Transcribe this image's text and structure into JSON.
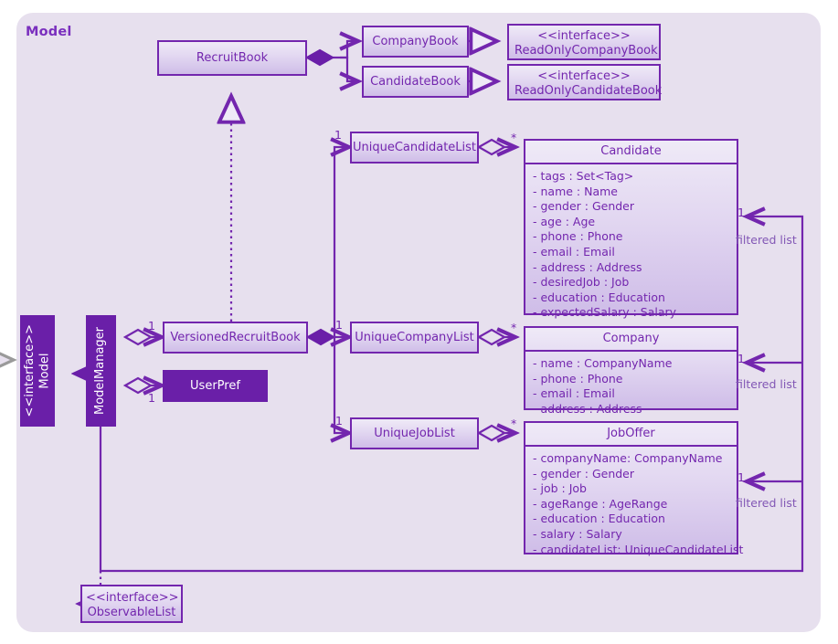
{
  "frame": {
    "title": "Model"
  },
  "classes": {
    "recruit_book": {
      "name": "RecruitBook"
    },
    "company_book": {
      "name": "CompanyBook"
    },
    "candidate_book": {
      "name": "CandidateBook"
    },
    "ro_company_book": {
      "stereotype": "<<interface>>",
      "name": "ReadOnlyCompanyBook"
    },
    "ro_candidate_book": {
      "stereotype": "<<interface>>",
      "name": "ReadOnlyCandidateBook"
    },
    "model": {
      "stereotype": "<<interface>>",
      "name": "Model"
    },
    "model_manager": {
      "name": "ModelManager"
    },
    "versioned_recruitbook": {
      "name": "VersionedRecruitBook"
    },
    "user_pref": {
      "name": "UserPref"
    },
    "observable_list": {
      "stereotype": "<<interface>>",
      "name": "ObservableList"
    },
    "unique_candidate_list": {
      "name": "UniqueCandidateList"
    },
    "unique_company_list": {
      "name": "UniqueCompanyList"
    },
    "unique_job_list": {
      "name": "UniqueJobList"
    },
    "candidate": {
      "name": "Candidate",
      "attributes": [
        "- tags : Set<Tag>",
        "- name : Name",
        "- gender : Gender",
        "- age : Age",
        "- phone : Phone",
        "- email : Email",
        "- address : Address",
        "- desiredJob : Job",
        "- education : Education",
        "- expectedSalary : Salary"
      ]
    },
    "company": {
      "name": "Company",
      "attributes": [
        "- name : CompanyName",
        "- phone : Phone",
        "- email : Email",
        "- address : Address"
      ]
    },
    "joboffer": {
      "name": "JobOffer",
      "attributes": [
        "- companyName: CompanyName",
        "- gender : Gender",
        "- job : Job",
        "- ageRange : AgeRange",
        "- education : Education",
        "- salary : Salary",
        "- candidateList: UniqueCandidateList"
      ]
    }
  },
  "multiplicities": {
    "m_ucl": "1",
    "m_ucol": "1",
    "m_ujl": "1",
    "m_cand_star": "*",
    "m_comp_star": "*",
    "m_job_star": "*",
    "m_vrb": "1",
    "m_userpref": "1",
    "m_filtered_candidate": "1",
    "m_filtered_company": "1",
    "m_filtered_job": "1"
  },
  "roles": {
    "filtered_candidate": "filtered list",
    "filtered_company": "filtered list",
    "filtered_job": "filtered list"
  },
  "colors": {
    "frame_bg": "#e7e0ee",
    "stroke": "#7326ae",
    "solid_fill": "#6a1fa8",
    "title_text": "#7a2fbe",
    "box_grad_top": "#efeaf7",
    "box_grad_bottom": "#cfbde8",
    "dotted_gray": "#9a9a9a"
  }
}
